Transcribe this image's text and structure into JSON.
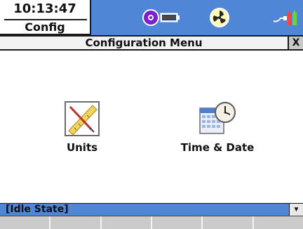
{
  "status_bar": {
    "time": "10:13:47",
    "mode": "Config",
    "icons": [
      "disc-icon",
      "battery-icon",
      "cooling-fan-icon",
      "power-supply-icon"
    ]
  },
  "title_bar": {
    "title": "Configuration Menu",
    "close_label": "X"
  },
  "menu": {
    "items": [
      {
        "label": "Units",
        "icon": "ruler-pencil-icon"
      },
      {
        "label": "Time & Date",
        "icon": "clock-calendar-icon"
      }
    ]
  },
  "footer": {
    "state": "[Idle State]",
    "scroll_glyph": "▼",
    "softkey_count": 6
  },
  "colors": {
    "accent_blue": "#4f86d6",
    "background": "#ffffff"
  }
}
